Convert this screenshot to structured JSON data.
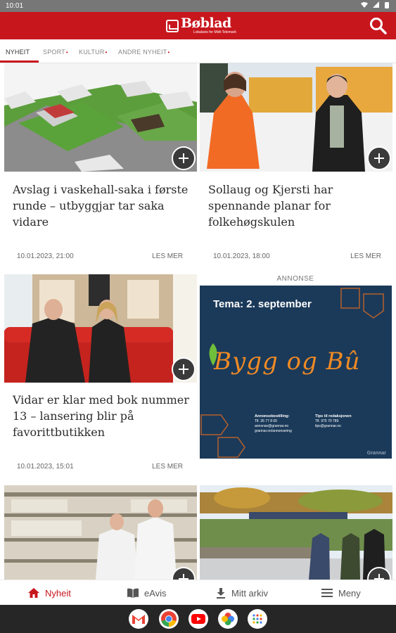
{
  "status_bar": {
    "time": "10:01",
    "icons": [
      "wifi-icon",
      "signal-icon",
      "battery-icon"
    ]
  },
  "header": {
    "logo_title": "Bøblad",
    "logo_subtitle": "Lokalavis for Midt-Telemark",
    "brand_color": "#c8161d",
    "search_icon": "search-icon"
  },
  "tabs": [
    {
      "label": "NYHEIT",
      "active": true
    },
    {
      "label": "SPORT",
      "dot": "•"
    },
    {
      "label": "KULTUR",
      "dot": "•"
    },
    {
      "label": "ANDRE NYHEIT",
      "dot": "•"
    }
  ],
  "articles": [
    {
      "headline": "Avslag i vaskehall-saka i første runde – utbyggjar tar saka vidare",
      "date": "10.01.2023, 21:00",
      "read_more": "LES MER"
    },
    {
      "headline": "Sollaug og Kjersti har spennande planar for folkehøgskulen",
      "date": "10.01.2023, 18:00",
      "read_more": "LES MER"
    },
    {
      "headline": "Vidar er klar med bok nummer 13 – lansering blir på favorittbutikken",
      "date": "10.01.2023, 15:01",
      "read_more": "LES MER"
    }
  ],
  "ad": {
    "label": "ANNONSE",
    "title": "Tema: 2. september",
    "brand": "Bygg og Bû",
    "info_left_title": "Annonsebestilling:",
    "info_left_lines": [
      "Tlf. 35 77 8 00",
      "annonse@grannar.no",
      "grannar.no/annonsering"
    ],
    "info_right_title": "Tips til redaksjonen",
    "info_right_lines": [
      "Tlf. 975 70 789",
      "tips@grannar.no"
    ],
    "corner": "Grannar"
  },
  "bottom_nav": [
    {
      "label": "Nyheit",
      "icon": "home-icon",
      "active": true
    },
    {
      "label": "eAvis",
      "icon": "book-icon"
    },
    {
      "label": "Mitt arkiv",
      "icon": "download-icon"
    },
    {
      "label": "Meny",
      "icon": "menu-icon"
    }
  ],
  "system_apps": [
    "gmail-icon",
    "chrome-icon",
    "youtube-icon",
    "photos-icon",
    "app-drawer-icon"
  ]
}
